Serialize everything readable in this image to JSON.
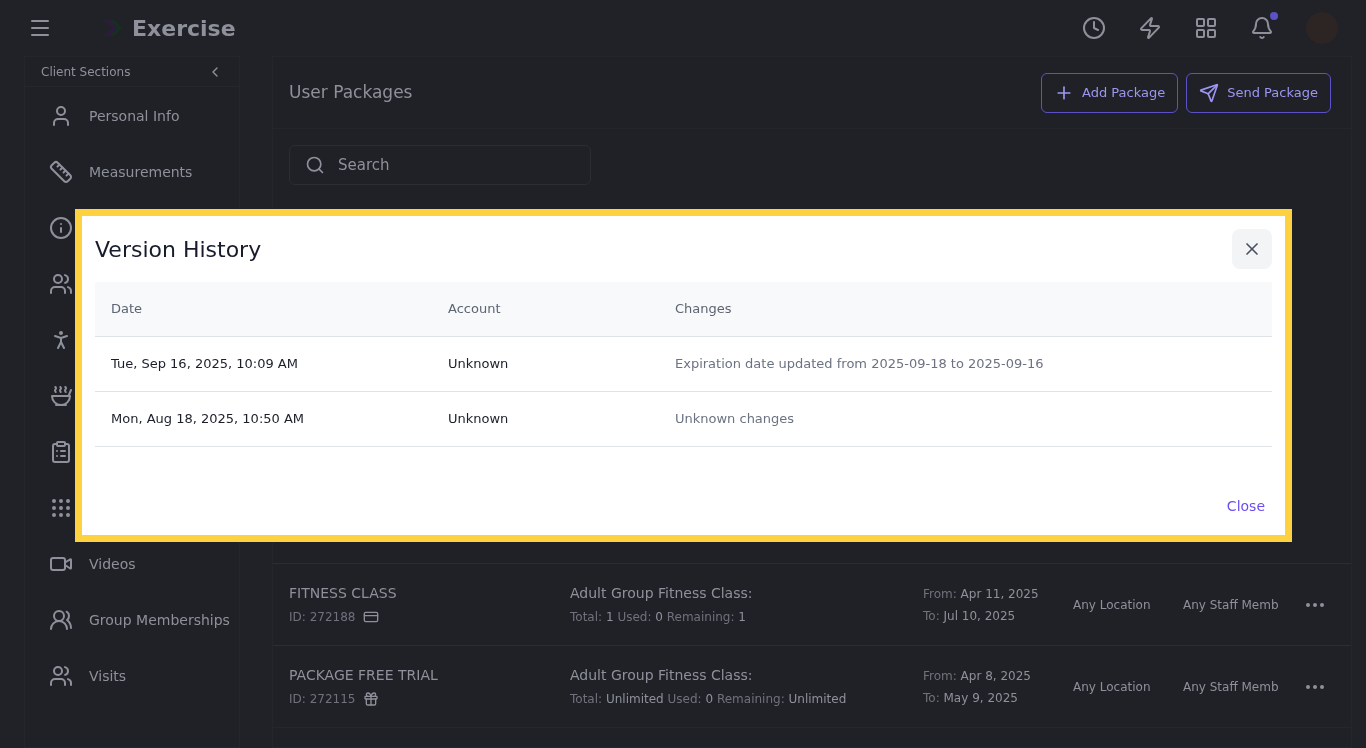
{
  "header": {
    "app_name": "Exercise",
    "notification_dot": true
  },
  "sidebar": {
    "title": "Client Sections",
    "items": [
      {
        "kind": "labeled",
        "label": "Personal Info"
      },
      {
        "kind": "labeled",
        "label": "Measurements"
      },
      {
        "kind": "icon"
      },
      {
        "kind": "icon"
      },
      {
        "kind": "icon"
      },
      {
        "kind": "icon"
      },
      {
        "kind": "icon"
      },
      {
        "kind": "icon"
      },
      {
        "kind": "labeled",
        "label": "Videos"
      },
      {
        "kind": "labeled",
        "label": "Group Memberships"
      },
      {
        "kind": "labeled",
        "label": "Visits"
      }
    ]
  },
  "main": {
    "title": "User Packages",
    "buttons": [
      {
        "label": "Add Package"
      },
      {
        "label": "Send Package"
      }
    ],
    "search": {
      "placeholder": "Search"
    },
    "packages": [
      {
        "name": "FITNESS CLASS",
        "id_label": "ID:",
        "id": "272188",
        "class_name": "Adult Group Fitness Class:",
        "total_label": "Total:",
        "total": "1",
        "used_label": "Used:",
        "used": "0",
        "remaining_label": "Remaining:",
        "remaining": "1",
        "from_label": "From:",
        "from": "Apr 11, 2025",
        "to_label": "To:",
        "to": "Jul 10, 2025",
        "location": "Any Location",
        "staff": "Any Staff Memb"
      },
      {
        "name": "PACKAGE FREE TRIAL",
        "id_label": "ID:",
        "id": "272115",
        "class_name": "Adult Group Fitness Class:",
        "total_label": "Total:",
        "total": "Unlimited",
        "used_label": "Used:",
        "used": "0",
        "remaining_label": "Remaining:",
        "remaining": "Unlimited",
        "from_label": "From:",
        "from": "Apr 8, 2025",
        "to_label": "To:",
        "to": "May 9, 2025",
        "location": "Any Location",
        "staff": "Any Staff Memb"
      }
    ]
  },
  "modal": {
    "title": "Version History",
    "columns": [
      "Date",
      "Account",
      "Changes"
    ],
    "rows": [
      {
        "date": "Tue, Sep 16, 2025, 10:09 AM",
        "account": "Unknown",
        "changes": "Expiration date updated from 2025-09-18 to 2025-09-16"
      },
      {
        "date": "Mon, Aug 18, 2025, 10:50 AM",
        "account": "Unknown",
        "changes": "Unknown changes"
      }
    ],
    "close_label": "Close"
  }
}
